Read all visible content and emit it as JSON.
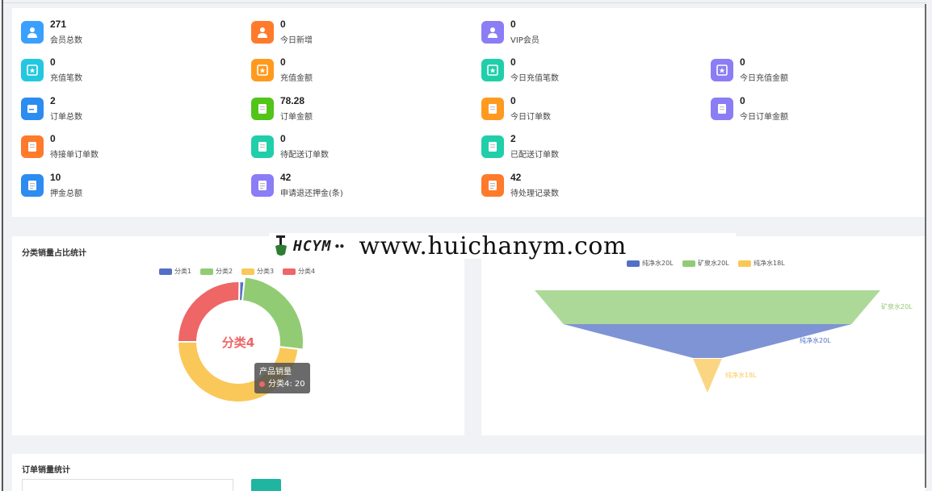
{
  "stats": [
    {
      "value": "271",
      "label": "会员总数",
      "icon": "user-icon",
      "color": "#3aa0ff"
    },
    {
      "value": "0",
      "label": "今日新增",
      "icon": "user-icon",
      "color": "#ff7a2b"
    },
    {
      "value": "0",
      "label": "VIP会员",
      "icon": "user-icon",
      "color": "#8b7df5"
    },
    {
      "value": "0",
      "label": "充值笔数",
      "icon": "wallet-icon",
      "color": "#23c8e0"
    },
    {
      "value": "0",
      "label": "充值金额",
      "icon": "wallet-icon",
      "color": "#ff9a1f"
    },
    {
      "value": "0",
      "label": "今日充值笔数",
      "icon": "wallet-icon",
      "color": "#20cfa9"
    },
    {
      "value": "0",
      "label": "今日充值金额",
      "icon": "wallet-icon",
      "color": "#8b7df5"
    },
    {
      "value": "2",
      "label": "订单总数",
      "icon": "card-icon",
      "color": "#2d8cf0"
    },
    {
      "value": "78.28",
      "label": "订单金额",
      "icon": "document-icon",
      "color": "#52c41a"
    },
    {
      "value": "0",
      "label": "今日订单数",
      "icon": "document-icon",
      "color": "#ff9a1f"
    },
    {
      "value": "0",
      "label": "今日订单金额",
      "icon": "document-icon",
      "color": "#8b7df5"
    },
    {
      "value": "0",
      "label": "待接单订单数",
      "icon": "document-icon",
      "color": "#ff7a2b"
    },
    {
      "value": "0",
      "label": "待配送订单数",
      "icon": "document-icon",
      "color": "#20cfa9"
    },
    {
      "value": "2",
      "label": "已配送订单数",
      "icon": "document-icon",
      "color": "#20cfa9"
    },
    {
      "value": "10",
      "label": "押金总额",
      "icon": "list-icon",
      "color": "#2d8cf0"
    },
    {
      "value": "42",
      "label": "申请退还押金(条)",
      "icon": "list-icon",
      "color": "#8b7df5"
    },
    {
      "value": "42",
      "label": "待处理记录数",
      "icon": "list-icon",
      "color": "#ff7a2b"
    }
  ],
  "watermark": {
    "logo": "HCYM",
    "url": "www.huichanym.com"
  },
  "pie_panel": {
    "title": "分类销量占比统计",
    "center_label": "分类4",
    "tooltip": {
      "title": "产品销量",
      "item": "分类4: 20"
    }
  },
  "orders_panel": {
    "title": "订单销量统计"
  },
  "chart_data": [
    {
      "type": "pie",
      "title": "分类销量占比统计",
      "categories": [
        "分类1",
        "分类2",
        "分类3",
        "分类4"
      ],
      "values": [
        1,
        20,
        38,
        20
      ],
      "colors": [
        "#5470c6",
        "#91cc75",
        "#fac858",
        "#ee6666"
      ],
      "legend": "top-center"
    },
    {
      "type": "funnel",
      "categories": [
        "纯净水20L",
        "矿泉水20L",
        "纯净水18L"
      ],
      "values": [
        10,
        12,
        1
      ],
      "colors": [
        "#5470c6",
        "#91cc75",
        "#fac858"
      ],
      "legend": "top-center"
    }
  ]
}
